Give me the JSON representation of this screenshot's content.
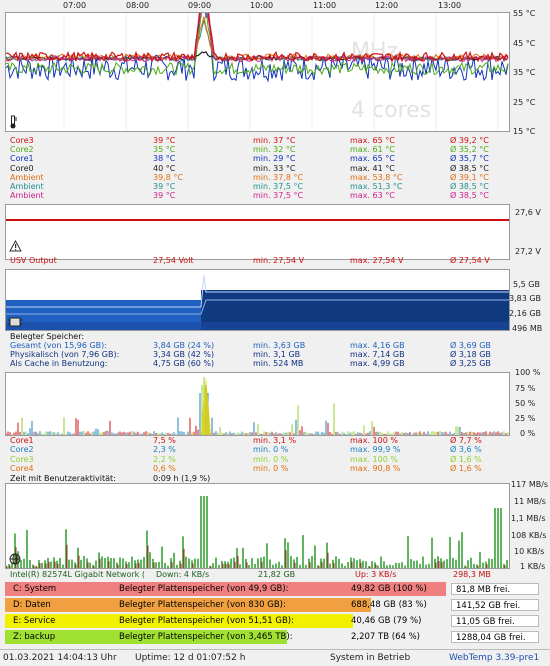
{
  "timeline": [
    "07:00",
    "08:00",
    "09:00",
    "10:00",
    "11:00",
    "12:00",
    "13:00"
  ],
  "temp": {
    "y_labels": [
      "55 °C",
      "45 °C",
      "35 °C",
      "25 °C",
      "15 °C"
    ],
    "watermark_mhz": "MHz",
    "watermark_cores": "4 cores",
    "rows": [
      {
        "name": "Core3",
        "cur": "39 °C",
        "min": "min. 37 °C",
        "max": "max. 65 °C",
        "avg": "Ø 39,2 °C",
        "color": "#d01010"
      },
      {
        "name": "Core2",
        "cur": "35 °C",
        "min": "min. 32 °C",
        "max": "max. 61 °C",
        "avg": "Ø 35,2 °C",
        "color": "#4caa18"
      },
      {
        "name": "Core1",
        "cur": "38 °C",
        "min": "min. 29 °C",
        "max": "max. 65 °C",
        "avg": "Ø 35,7 °C",
        "color": "#1030c0"
      },
      {
        "name": "Core0",
        "cur": "40 °C",
        "min": "min. 33 °C",
        "max": "max. 41 °C",
        "avg": "Ø 38,5 °C",
        "color": "#202020"
      },
      {
        "name": "Ambient",
        "cur": "39,8 °C",
        "min": "min. 37,8 °C",
        "max": "max. 53,8 °C",
        "avg": "Ø 39,1 °C",
        "color": "#e07010"
      },
      {
        "name": "Ambient",
        "cur": "39 °C",
        "min": "min. 37,5 °C",
        "max": "max. 51,3 °C",
        "avg": "Ø 38,5 °C",
        "color": "#209090"
      },
      {
        "name": "Ambient",
        "cur": "39 °C",
        "min": "min. 37,5 °C",
        "max": "max. 63 °C",
        "avg": "Ø 38,5 °C",
        "color": "#d02090"
      }
    ]
  },
  "usv": {
    "y_labels": [
      "27,6 V",
      "27,2 V"
    ],
    "name": "USV Output",
    "cur": "27,54 Volt",
    "min": "min. 27,54 V",
    "max": "max. 27,54 V",
    "avg": "Ø 27,54 V"
  },
  "mem": {
    "y_labels": [
      "5,5 GB",
      "3,83 GB",
      "2,16 GB",
      "496 MB"
    ],
    "header": "Belegter Speicher:",
    "rows": [
      {
        "name": "Gesamt (von 15,96 GB):",
        "cur": "3,84 GB (24 %)",
        "min": "min. 3,63 GB",
        "max": "max. 4,16 GB",
        "avg": "Ø 3,69 GB",
        "color": "#2060c0"
      },
      {
        "name": "Physikalisch (von 7,96 GB):",
        "cur": "3,34 GB (42 %)",
        "min": "min. 3,1 GB",
        "max": "max. 7,14 GB",
        "avg": "Ø 3,18 GB",
        "color": "#103080"
      },
      {
        "name": "Als Cache in Benutzung:",
        "cur": "4,75 GB (60 %)",
        "min": "min. 524 MB",
        "max": "max. 4,99 GB",
        "avg": "Ø 3,25 GB",
        "color": "#103080"
      }
    ]
  },
  "cpu": {
    "y_labels": [
      "100 %",
      "75 %",
      "50 %",
      "25 %",
      "0 %"
    ],
    "rows": [
      {
        "name": "Core1",
        "cur": "7,5 %",
        "min": "min. 3,1 %",
        "max": "max. 100 %",
        "avg": "Ø 7,7 %",
        "color": "#d01010"
      },
      {
        "name": "Core2",
        "cur": "2,3 %",
        "min": "min. 0 %",
        "max": "max. 99,9 %",
        "avg": "Ø 3,6 %",
        "color": "#2080c0"
      },
      {
        "name": "Core3",
        "cur": "2,2 %",
        "min": "min. 0 %",
        "max": "max. 100 %",
        "avg": "Ø 1,6 %",
        "color": "#90d030"
      },
      {
        "name": "Core4",
        "cur": "0,6 %",
        "min": "min. 0 %",
        "max": "max. 90,8 %",
        "avg": "Ø 1,6 %",
        "color": "#e07010"
      }
    ],
    "activity_label": "Zeit mit Benutzeraktivität:",
    "activity_value": "0:09 h (1,9 %)"
  },
  "net": {
    "y_labels": [
      "117 MB/s",
      "11 MB/s",
      "1,1 MB/s",
      "108 KB/s",
      "10 KB/s",
      "1 KB/s"
    ],
    "adapter": "Intel(R) 82574L Gigabit Network (",
    "down_label": "Down: 4 KB/s",
    "down_total": "21,82 GB",
    "up_label": "Up: 3 KB/s",
    "up_total": "298,3 MB"
  },
  "disks": [
    {
      "name": "C: System",
      "desc": "Belegter Plattenspeicher (von 49,9 GB):",
      "used": "49,82 GB (100 %)",
      "free": "81,8 MB frei.",
      "color": "#f08080",
      "fill": 1.0
    },
    {
      "name": "D: Daten",
      "desc": "Belegter Plattenspeicher (von 830 GB):",
      "used": "688,48 GB (83 %)",
      "free": "141,52 GB frei.",
      "color": "#f0a040",
      "fill": 0.83
    },
    {
      "name": "E: Service",
      "desc": "Belegter Plattenspeicher (von 51,51 GB):",
      "used": "40,46 GB (79 %)",
      "free": "11,05 GB frei.",
      "color": "#f0f000",
      "fill": 0.79
    },
    {
      "name": "Z: backup",
      "desc": "Belegter Plattenspeicher (von 3,465 TB):",
      "used": "2,207 TB (64 %)",
      "free": "1288,04 GB frei.",
      "color": "#a0e030",
      "fill": 0.64
    }
  ],
  "status": {
    "datetime": "01.03.2021 14:04:13 Uhr",
    "uptime": "Uptime: 12 d 01:07:52 h",
    "state": "System in Betrieb",
    "version": "WebTemp 3.39-pre1"
  },
  "colors": {
    "accent": "#2050b0",
    "grid": "#d0d0d0"
  },
  "icons": [
    "thermometer-icon",
    "warning-icon",
    "memory-chip-icon",
    "network-icon"
  ]
}
